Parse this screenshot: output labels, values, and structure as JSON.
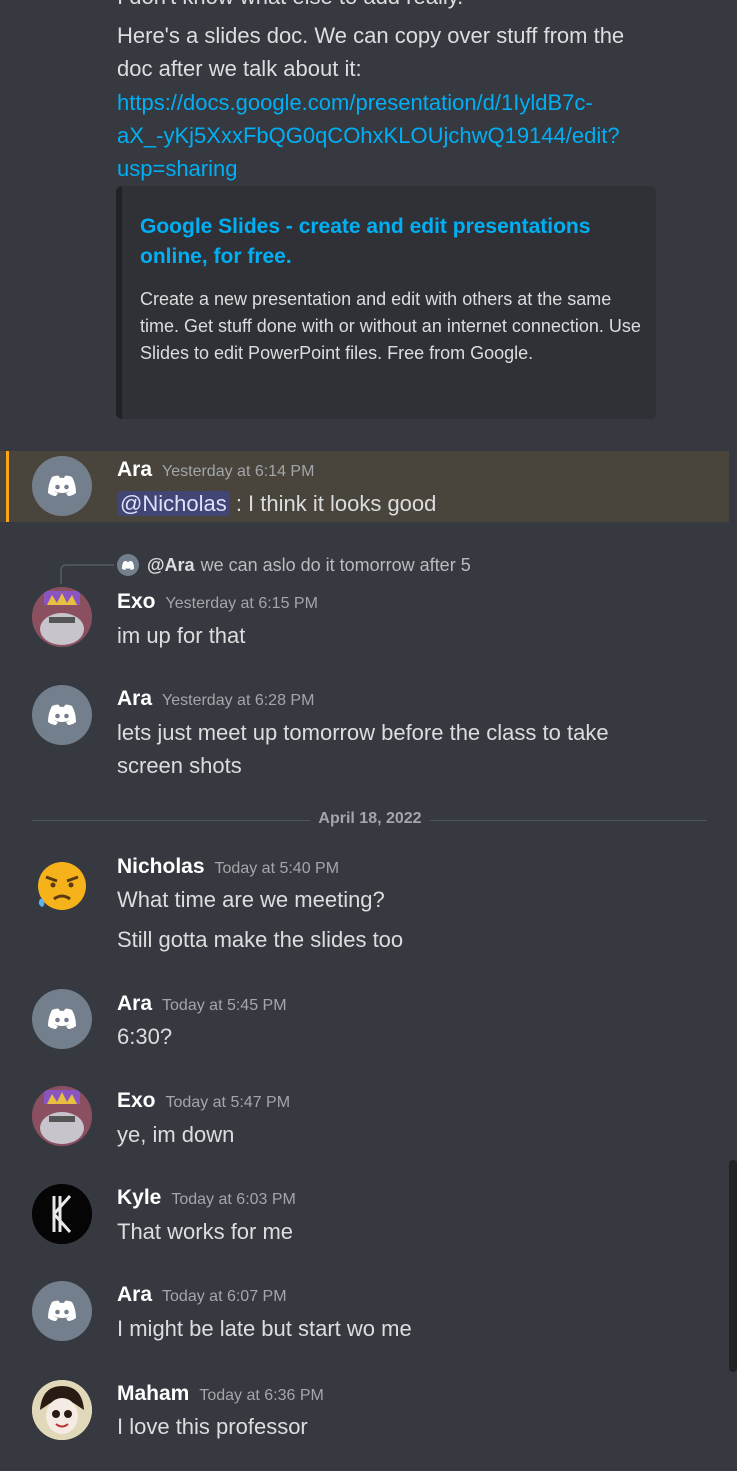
{
  "messages_top": {
    "cut_line": "I don't know what else to add really.",
    "line1": "Here's a slides doc. We can copy over stuff from the",
    "line2": "doc after we talk about it:",
    "link1": "https://docs.google.com/presentation/d/1IyldB7c-",
    "link2": "aX_-yKj5XxxFbQG0qCOhxKLOUjchwQ19144/edit?",
    "link3": "usp=sharing"
  },
  "embed": {
    "title": "Google Slides - create and edit presentations online, for free.",
    "description": "Create a new presentation and edit with others at the same time. Get stuff done with or without an internet connection. Use Slides to edit PowerPoint files. Free from Google."
  },
  "msg_ara1": {
    "author": "Ara",
    "time": "Yesterday at 6:14 PM",
    "mention": "@Nicholas",
    "text": ": I think it looks good"
  },
  "reply_exo": {
    "reply_author": "@Ara",
    "reply_text": "we can aslo do it tomorrow after 5"
  },
  "msg_exo1": {
    "author": "Exo",
    "time": "Yesterday at 6:15 PM",
    "text": "im up for that"
  },
  "msg_ara2": {
    "author": "Ara",
    "time": "Yesterday at 6:28 PM",
    "text1": "lets just meet up tomorrow before the class to take",
    "text2": "screen shots"
  },
  "divider": {
    "date": "April 18, 2022"
  },
  "msg_nicholas": {
    "author": "Nicholas",
    "time": "Today at 5:40 PM",
    "text1": "What time are we meeting?",
    "text2": "Still gotta make the slides too"
  },
  "msg_ara3": {
    "author": "Ara",
    "time": "Today at 5:45 PM",
    "text": "6:30?"
  },
  "msg_exo2": {
    "author": "Exo",
    "time": "Today at 5:47 PM",
    "text": "ye, im down"
  },
  "msg_kyle": {
    "author": "Kyle",
    "time": "Today at 6:03 PM",
    "text": "That works for me"
  },
  "msg_ara4": {
    "author": "Ara",
    "time": "Today at 6:07 PM",
    "text": "I might be late but start wo me"
  },
  "msg_maham": {
    "author": "Maham",
    "time": "Today at 6:36 PM",
    "text": "I love this professor"
  },
  "colors": {
    "background": "#36393f",
    "link": "#00aff4",
    "highlight": "#49443c",
    "highlight_bar": "#faa81a",
    "mention_bg": "#414675"
  },
  "icons": {
    "discord_avatar": "discord-logo-icon"
  }
}
